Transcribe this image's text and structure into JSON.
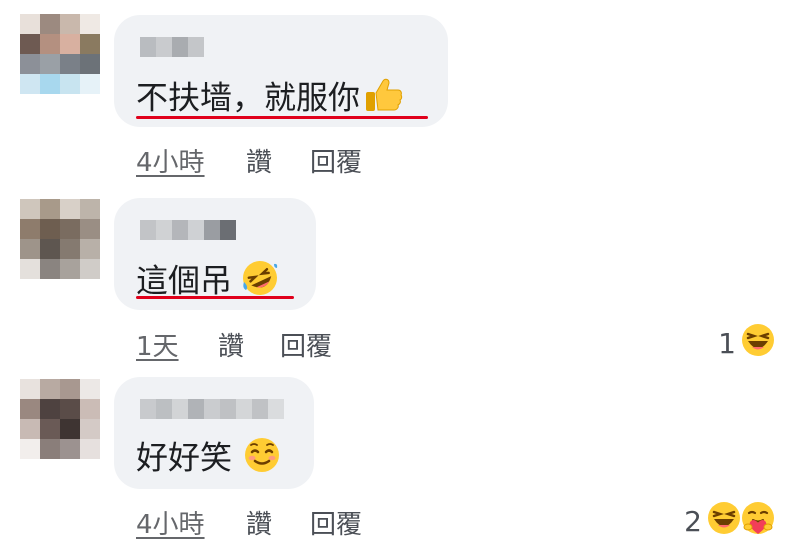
{
  "comments": [
    {
      "text": "不扶墙，就服你",
      "emoji": "thumbs-up-icon",
      "time": "4小時",
      "like": "讚",
      "reply": "回覆",
      "reaction_count": "",
      "reactions": []
    },
    {
      "text": "這個吊",
      "emoji": "rolling-laughing-icon",
      "time": "1天",
      "like": "讚",
      "reply": "回覆",
      "reaction_count": "1",
      "reactions": [
        "haha-icon"
      ]
    },
    {
      "text": "好好笑",
      "emoji": "smiling-blush-icon",
      "time": "4小時",
      "like": "讚",
      "reply": "回覆",
      "reaction_count": "2",
      "reactions": [
        "haha-icon",
        "care-icon"
      ]
    }
  ],
  "colors": {
    "bubble": "#f0f2f5",
    "underline": "#e0001b",
    "emoji_yellow": "#ffcc33"
  }
}
